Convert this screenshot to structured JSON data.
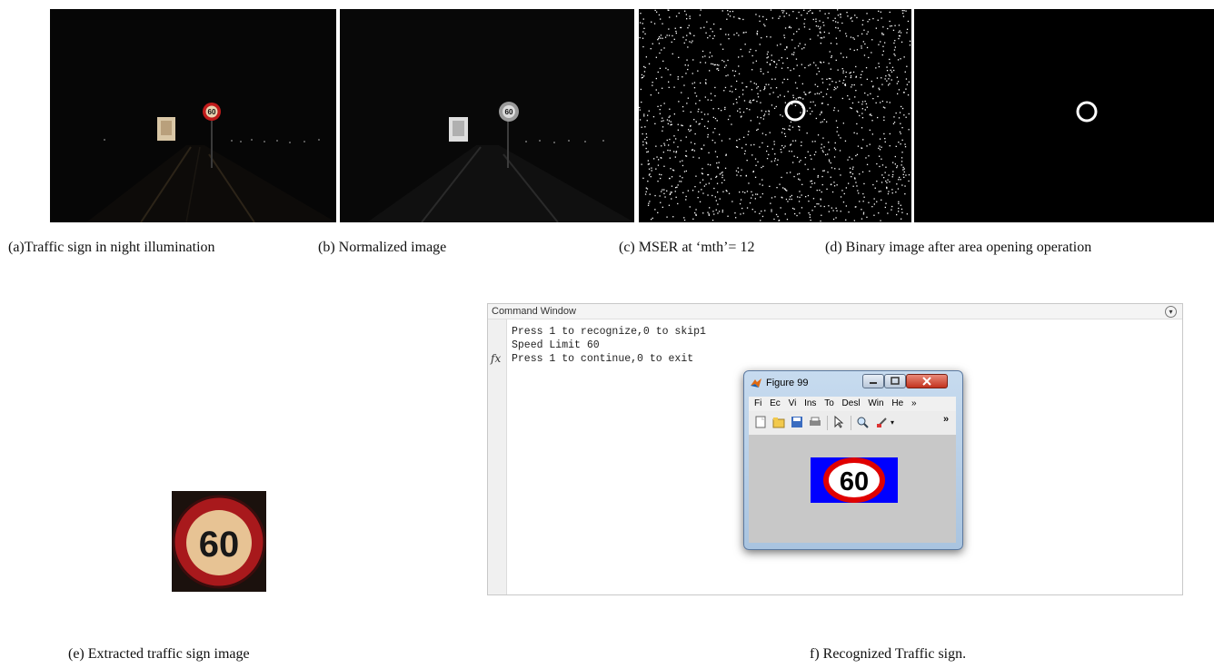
{
  "captions": {
    "a": "(a)Traffic sign in night illumination",
    "b": "(b) Normalized image",
    "c": "(c) MSER at ‘mth’= 12",
    "d": "(d) Binary image after area opening operation",
    "e": "(e) Extracted traffic sign image",
    "f": "f) Recognized Traffic sign."
  },
  "signs": {
    "night_sign_text": "60",
    "normalized_sign_text": "60",
    "extracted_sign_text": "60"
  },
  "command_window": {
    "title": "Command Window",
    "prompt_symbol": "fx",
    "lines": [
      "Press 1 to recognize,0 to skip1",
      "Speed Limit 60",
      "Press 1 to continue,0 to exit"
    ]
  },
  "figure_window": {
    "title": "Figure 99",
    "menus": [
      "Fi",
      "Ec",
      "Vi",
      "Ins",
      "To",
      "Desl",
      "Win",
      "He"
    ],
    "menu_overflow": "»",
    "toolbar_overflow": "»",
    "recognized_sign_text": "60",
    "colors": {
      "background": "#0000ff",
      "ring": "#e00000",
      "fill": "#ffffff"
    }
  },
  "icons": {
    "window_minimize": "minimize-icon",
    "window_maximize": "maximize-icon",
    "window_close": "close-icon",
    "matlab_logo": "matlab-logo-icon"
  }
}
